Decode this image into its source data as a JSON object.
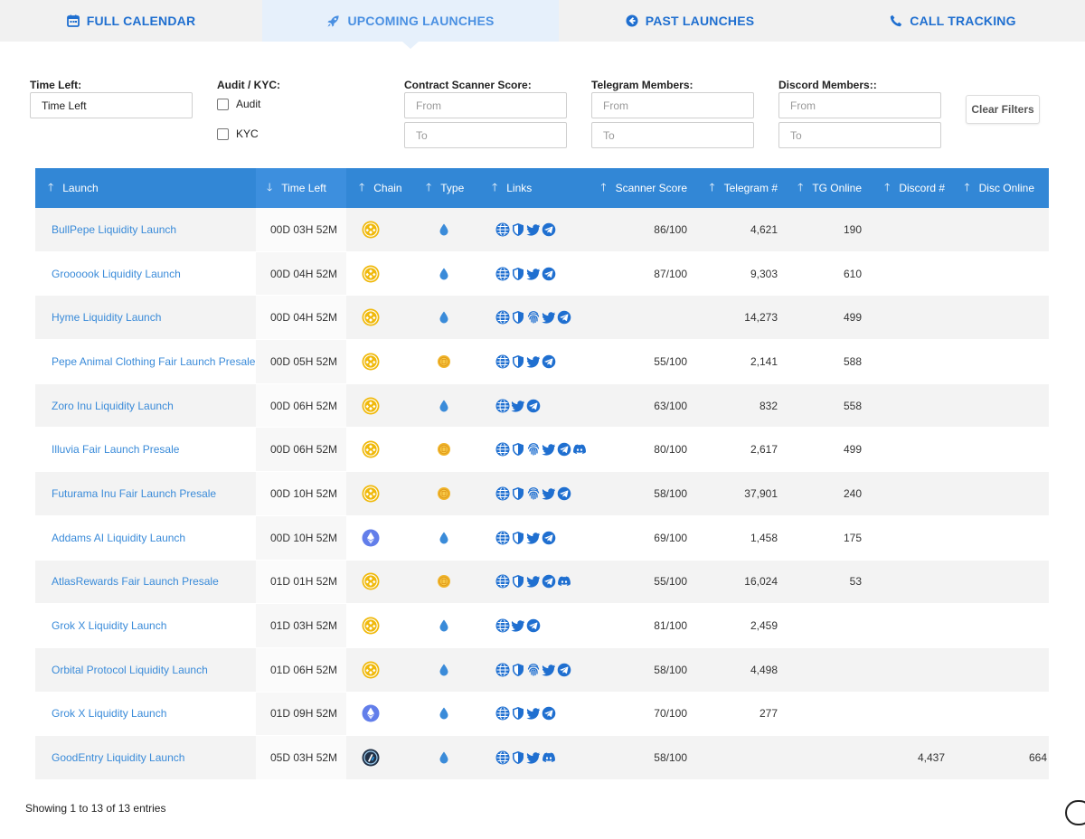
{
  "nav": {
    "tabs": [
      {
        "label": "FULL CALENDAR",
        "icon": "calendar-icon"
      },
      {
        "label": "UPCOMING LAUNCHES",
        "icon": "rocket-icon",
        "active": true
      },
      {
        "label": "PAST LAUNCHES",
        "icon": "back-arrow-icon"
      },
      {
        "label": "CALL TRACKING",
        "icon": "phone-icon"
      }
    ]
  },
  "filters": {
    "time_left": {
      "label": "Time Left:",
      "value": "Time Left"
    },
    "audit_kyc": {
      "label": "Audit / KYC:",
      "audit": "Audit",
      "kyc": "KYC"
    },
    "scanner": {
      "label": "Contract Scanner Score:",
      "from": "From",
      "to": "To"
    },
    "telegram": {
      "label": "Telegram Members:",
      "from": "From",
      "to": "To"
    },
    "discord": {
      "label": "Discord Members::",
      "from": "From",
      "to": "To"
    },
    "clear": "Clear Filters"
  },
  "colors": {
    "accent": "#1f6fd0",
    "header_bg": "#3287d6",
    "link": "#3a8bd9",
    "bsc": "#f0b90b",
    "eth": "#627eea",
    "drop": "#3a8bd9"
  },
  "table": {
    "headers": {
      "launch": "Launch",
      "time": "Time Left",
      "chain": "Chain",
      "type": "Type",
      "links": "Links",
      "score": "Scanner Score",
      "tg": "Telegram #",
      "tgo": "TG Online",
      "disc": "Discord #",
      "disco": "Disc Online"
    },
    "rows": [
      {
        "name": "BullPepe Liquidity Launch",
        "time": "00D 03H 52M",
        "chain": "bsc",
        "type": "liquidity",
        "links": [
          "web",
          "shield",
          "twitter",
          "telegram"
        ],
        "score": "86/100",
        "tg": "4,621",
        "tgo": "190",
        "disc": "",
        "disco": ""
      },
      {
        "name": "Groooook Liquidity Launch",
        "time": "00D 04H 52M",
        "chain": "bsc",
        "type": "liquidity",
        "links": [
          "web",
          "shield",
          "twitter",
          "telegram"
        ],
        "score": "87/100",
        "tg": "9,303",
        "tgo": "610",
        "disc": "",
        "disco": ""
      },
      {
        "name": "Hyme Liquidity Launch",
        "time": "00D 04H 52M",
        "chain": "bsc",
        "type": "liquidity",
        "links": [
          "web",
          "shield",
          "fingerprint",
          "twitter",
          "telegram"
        ],
        "score": "",
        "tg": "14,273",
        "tgo": "499",
        "disc": "",
        "disco": ""
      },
      {
        "name": "Pepe Animal Clothing Fair Launch Presale",
        "time": "00D 05H 52M",
        "chain": "bsc",
        "type": "presale",
        "links": [
          "web",
          "shield",
          "twitter",
          "telegram"
        ],
        "score": "55/100",
        "tg": "2,141",
        "tgo": "588",
        "disc": "",
        "disco": ""
      },
      {
        "name": "Zoro Inu Liquidity Launch",
        "time": "00D 06H 52M",
        "chain": "bsc",
        "type": "liquidity",
        "links": [
          "web",
          "twitter",
          "telegram"
        ],
        "score": "63/100",
        "tg": "832",
        "tgo": "558",
        "disc": "",
        "disco": ""
      },
      {
        "name": "Illuvia Fair Launch Presale",
        "time": "00D 06H 52M",
        "chain": "bsc",
        "type": "presale",
        "links": [
          "web",
          "shield",
          "fingerprint",
          "twitter",
          "telegram",
          "discord"
        ],
        "score": "80/100",
        "tg": "2,617",
        "tgo": "499",
        "disc": "",
        "disco": ""
      },
      {
        "name": "Futurama Inu Fair Launch Presale",
        "time": "00D 10H 52M",
        "chain": "bsc",
        "type": "presale",
        "links": [
          "web",
          "shield",
          "fingerprint",
          "twitter",
          "telegram"
        ],
        "score": "58/100",
        "tg": "37,901",
        "tgo": "240",
        "disc": "",
        "disco": ""
      },
      {
        "name": "Addams AI Liquidity Launch",
        "time": "00D 10H 52M",
        "chain": "eth",
        "type": "liquidity",
        "links": [
          "web",
          "shield",
          "twitter",
          "telegram"
        ],
        "score": "69/100",
        "tg": "1,458",
        "tgo": "175",
        "disc": "",
        "disco": ""
      },
      {
        "name": "AtlasRewards Fair Launch Presale",
        "time": "01D 01H 52M",
        "chain": "bsc",
        "type": "presale",
        "links": [
          "web",
          "shield",
          "twitter",
          "telegram",
          "discord"
        ],
        "score": "55/100",
        "tg": "16,024",
        "tgo": "53",
        "disc": "",
        "disco": ""
      },
      {
        "name": "Grok X Liquidity Launch",
        "time": "01D 03H 52M",
        "chain": "bsc",
        "type": "liquidity",
        "links": [
          "web",
          "twitter",
          "telegram"
        ],
        "score": "81/100",
        "tg": "2,459",
        "tgo": "",
        "disc": "",
        "disco": ""
      },
      {
        "name": "Orbital Protocol Liquidity Launch",
        "time": "01D 06H 52M",
        "chain": "bsc",
        "type": "liquidity",
        "links": [
          "web",
          "shield",
          "fingerprint",
          "twitter",
          "telegram"
        ],
        "score": "58/100",
        "tg": "4,498",
        "tgo": "",
        "disc": "",
        "disco": ""
      },
      {
        "name": "Grok X Liquidity Launch",
        "time": "01D 09H 52M",
        "chain": "eth",
        "type": "liquidity",
        "links": [
          "web",
          "shield",
          "twitter",
          "telegram"
        ],
        "score": "70/100",
        "tg": "277",
        "tgo": "",
        "disc": "",
        "disco": ""
      },
      {
        "name": "GoodEntry Liquidity Launch",
        "time": "05D 03H 52M",
        "chain": "arb",
        "type": "liquidity",
        "links": [
          "web",
          "shield",
          "twitter",
          "discord"
        ],
        "score": "58/100",
        "tg": "",
        "tgo": "",
        "disc": "4,437",
        "disco": "664"
      }
    ]
  },
  "footer": {
    "entries": "Showing 1 to 13 of 13 entries"
  }
}
